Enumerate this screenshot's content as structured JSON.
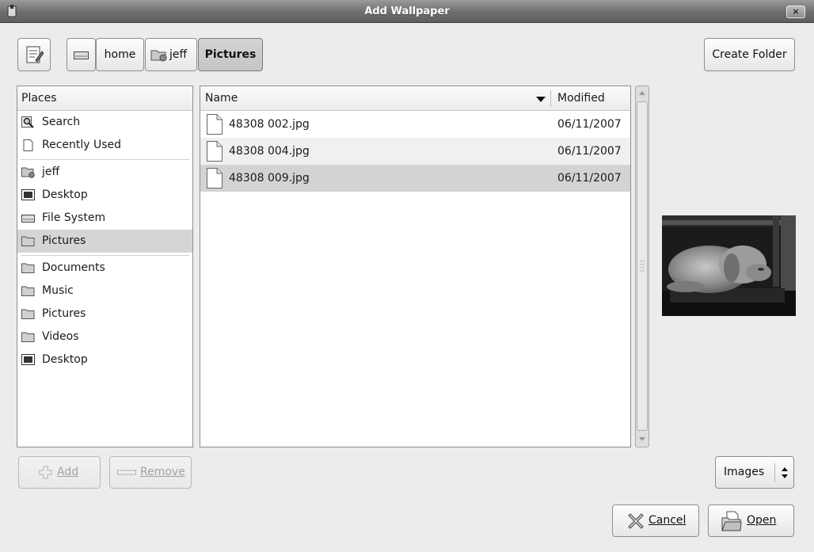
{
  "window": {
    "title": "Add Wallpaper",
    "close_glyph": "×"
  },
  "pathbar": {
    "edit_icon": "edit-location-icon",
    "crumbs": [
      {
        "label": "",
        "icon": "drive-icon"
      },
      {
        "label": "home"
      },
      {
        "label": "jeff",
        "icon": "home-folder-icon"
      },
      {
        "label": "Pictures",
        "active": true
      }
    ],
    "create_folder": "Create Folder"
  },
  "places": {
    "header": "Places",
    "items": [
      {
        "label": "Search",
        "icon": "search-icon"
      },
      {
        "label": "Recently Used",
        "icon": "document-icon"
      },
      {
        "label": "jeff",
        "icon": "home-folder-icon"
      },
      {
        "label": "Desktop",
        "icon": "desktop-icon"
      },
      {
        "label": "File System",
        "icon": "drive-icon"
      },
      {
        "label": "Pictures",
        "icon": "folder-icon",
        "selected": true
      },
      {
        "label": "Documents",
        "icon": "folder-icon"
      },
      {
        "label": "Music",
        "icon": "folder-icon"
      },
      {
        "label": "Pictures",
        "icon": "folder-icon"
      },
      {
        "label": "Videos",
        "icon": "folder-icon"
      },
      {
        "label": "Desktop",
        "icon": "desktop-icon"
      }
    ],
    "add": "Add",
    "remove": "Remove"
  },
  "files": {
    "columns": {
      "name": "Name",
      "modified": "Modified"
    },
    "rows": [
      {
        "name": "48308 002.jpg",
        "modified": "06/11/2007"
      },
      {
        "name": "48308 004.jpg",
        "modified": "06/11/2007"
      },
      {
        "name": "48308 009.jpg",
        "modified": "06/11/2007",
        "selected": true
      }
    ]
  },
  "filter": {
    "selected": "Images"
  },
  "actions": {
    "cancel": "Cancel",
    "open": "Open"
  }
}
